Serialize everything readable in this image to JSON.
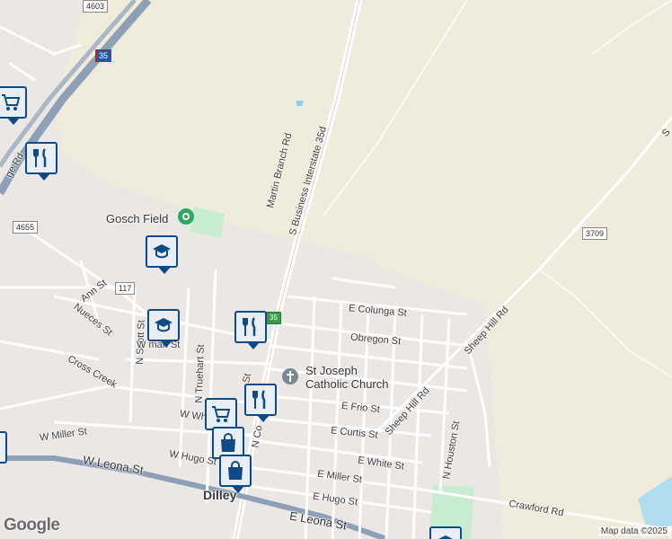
{
  "map": {
    "colors": {
      "land": "#ebe7e5",
      "field": "#f0ecdc",
      "park": "#c8ecd0",
      "road": "#ffffff",
      "highway": "#8da0b6",
      "pin_border": "#0e4a86"
    }
  },
  "labels": {
    "martin_branch_rd": "Martin Branch Rd",
    "i35_business": "S Business Interstate 35d",
    "gosch_field": "Gosch Field",
    "st_joseph_line1": "St Joseph",
    "st_joseph_line2": "Catholic Church",
    "e_colunga": "E Colunga St",
    "obregon": "Obregon St",
    "ann_st": "Ann St",
    "nueces_st": "Nueces St",
    "n_scott_st": "N Scott St",
    "cross_creek": "Cross Creek",
    "n_truehart_st": "N Truehart St",
    "w_whi": "W Whi",
    "w_man": "W man St",
    "w_miller_st": "W Miller St",
    "w_leona_st": "W Leona St",
    "w_hugo_st": "W Hugo St",
    "e_frio_st": "E Frio St",
    "e_curtis_st": "E Curtis St",
    "e_white_st": "E White St",
    "e_miller_st": "E Miller St",
    "e_hugo_st": "E Hugo St",
    "e_leona_st": "E Leona St",
    "crawford_rd": "Crawford Rd",
    "sheep_hill_rd_1": "Sheep Hill Rd",
    "sheep_hill_rd_2": "Sheep Hill Rd",
    "n_houston_st": "N Houston St",
    "dilley": "Dilley",
    "ge_rd": "ge Rd",
    "n_co": "N Co",
    "st_small": "St",
    "s_edge": "S"
  },
  "shields": {
    "r4603": "4603",
    "r4655": "4655",
    "r3709": "3709",
    "r117": "117",
    "i35": "35",
    "i35_small": "35"
  },
  "markers": [
    {
      "icon": "cart-icon",
      "label": "grocery"
    },
    {
      "icon": "restaurant-icon",
      "label": "restaurant"
    },
    {
      "icon": "school-icon",
      "label": "school"
    },
    {
      "icon": "school-icon",
      "label": "school"
    },
    {
      "icon": "restaurant-icon",
      "label": "restaurant"
    },
    {
      "icon": "restaurant-icon",
      "label": "restaurant"
    },
    {
      "icon": "cart-icon",
      "label": "grocery"
    },
    {
      "icon": "shopping-bag-icon",
      "label": "store"
    },
    {
      "icon": "shopping-bag-icon",
      "label": "store"
    },
    {
      "icon": "school-icon",
      "label": "school"
    }
  ],
  "footer": {
    "logo": "Google",
    "attribution": "Map data ©2025"
  }
}
